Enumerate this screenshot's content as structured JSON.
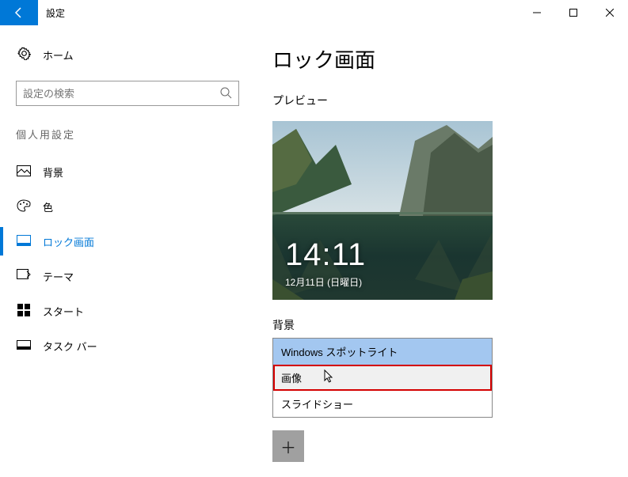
{
  "titlebar": {
    "title": "設定"
  },
  "sidebar": {
    "home": "ホーム",
    "search_placeholder": "設定の検索",
    "category": "個人用設定",
    "items": [
      {
        "label": "背景"
      },
      {
        "label": "色"
      },
      {
        "label": "ロック画面"
      },
      {
        "label": "テーマ"
      },
      {
        "label": "スタート"
      },
      {
        "label": "タスク バー"
      }
    ]
  },
  "main": {
    "title": "ロック画面",
    "preview_label": "プレビュー",
    "preview_time": "14:11",
    "preview_date": "12月11日 (日曜日)",
    "bg_label": "背景",
    "dropdown": [
      "Windows スポットライト",
      "画像",
      "スライドショー"
    ]
  }
}
